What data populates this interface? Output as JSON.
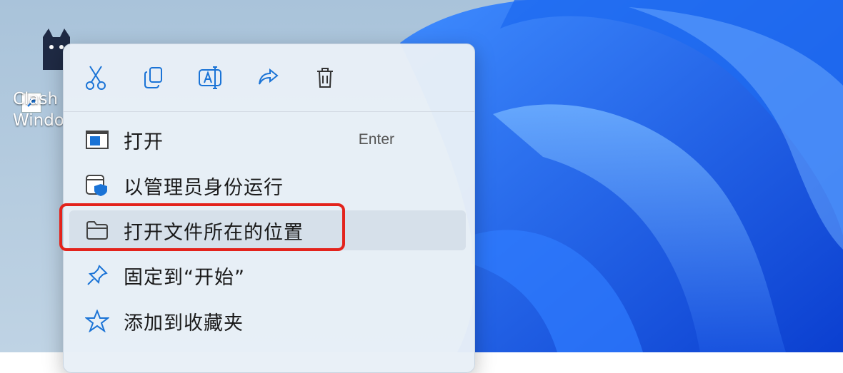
{
  "desktop": {
    "icon_label": "Clash\nWindo"
  },
  "toolbar": {
    "cut": "cut-icon",
    "copy": "copy-icon",
    "rename": "rename-icon",
    "share": "share-icon",
    "delete": "delete-icon"
  },
  "menu": {
    "items": [
      {
        "label": "打开",
        "shortcut": "Enter",
        "icon": "open-window-icon"
      },
      {
        "label": "以管理员身份运行",
        "shortcut": "",
        "icon": "admin-shield-icon"
      },
      {
        "label": "打开文件所在的位置",
        "shortcut": "",
        "icon": "folder-icon"
      },
      {
        "label": "固定到“开始”",
        "shortcut": "",
        "icon": "pin-icon"
      },
      {
        "label": "添加到收藏夹",
        "shortcut": "",
        "icon": "star-icon"
      }
    ]
  },
  "colors": {
    "accent": "#1a73d6",
    "highlight_border": "#e3231c"
  }
}
